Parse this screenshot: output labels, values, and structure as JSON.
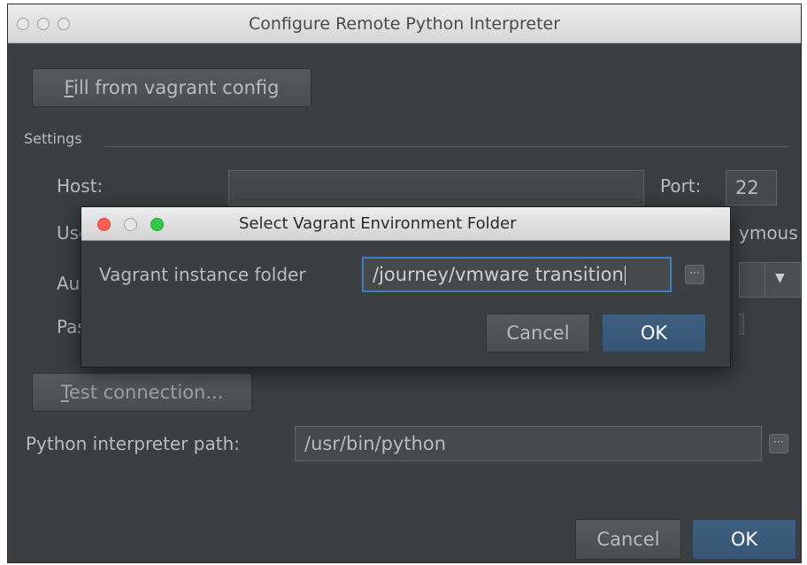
{
  "window": {
    "title": "Configure Remote Python Interpreter",
    "fill_button_mnemonic": "F",
    "fill_button_rest": "ill from vagrant config",
    "settings_label": "Settings",
    "host_label": "Host:",
    "host_value": "",
    "port_label": "Port:",
    "port_value": "22",
    "username_label_partial": "Use",
    "anonymous_partial": "ymous",
    "auth_label_partial": "Au",
    "password_label_partial": "Pas",
    "test_button_mnemonic": "T",
    "test_button_rest": "est connection...",
    "interpreter_label": "Python interpreter path:",
    "interpreter_value": "/usr/bin/python",
    "browse_label": "···",
    "dropdown_arrow": "▼",
    "cancel_label": "Cancel",
    "ok_label": "OK"
  },
  "dialog": {
    "title": "Select Vagrant Environment Folder",
    "folder_label": "Vagrant instance folder",
    "folder_value": "/journey/vmware transition",
    "browse_label": "···",
    "cancel_label": "Cancel",
    "ok_label": "OK"
  },
  "colors": {
    "background": "#3c3f41",
    "text": "#bbbbbb",
    "primary_button": "#365674",
    "focus_ring": "#3d7ec2",
    "traffic_close": "#fc5f57",
    "traffic_minimize": "#fdbc2e",
    "traffic_zoom": "#34c84a"
  },
  "icons": [
    "traffic-light-close-icon",
    "traffic-light-minimize-icon",
    "traffic-light-zoom-icon",
    "ellipsis-icon",
    "chevron-down-icon"
  ]
}
